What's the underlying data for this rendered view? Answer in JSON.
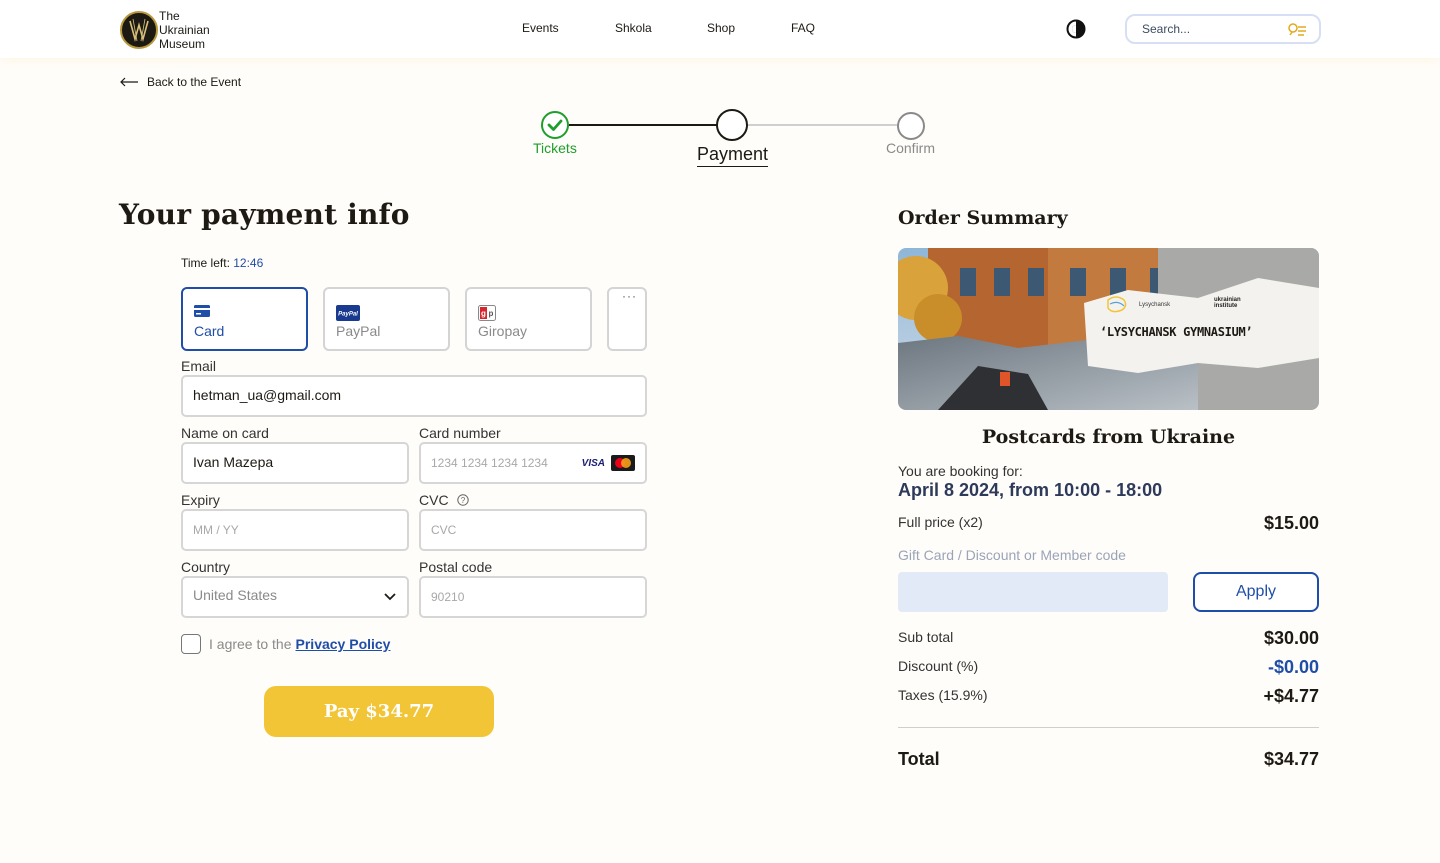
{
  "header": {
    "logo_lines": [
      "The",
      "Ukrainian",
      "Museum"
    ],
    "nav": [
      "Events",
      "Shkola",
      "Shop",
      "FAQ"
    ],
    "search_placeholder": "Search..."
  },
  "back_link": "Back to the Event",
  "stepper": {
    "steps": [
      {
        "label": "Tickets",
        "state": "done"
      },
      {
        "label": "Payment",
        "state": "current"
      },
      {
        "label": "Confirm",
        "state": "upcoming"
      }
    ]
  },
  "payment": {
    "title": "Your payment info",
    "time_left_label": "Time left:",
    "time_left_value": "12:46",
    "methods": [
      {
        "label": "Card",
        "icon": "card-icon",
        "active": true
      },
      {
        "label": "PayPal",
        "icon": "paypal-icon",
        "active": false
      },
      {
        "label": "Giropay",
        "icon": "giropay-icon",
        "active": false
      }
    ],
    "more_label": "···",
    "email": {
      "label": "Email",
      "value": "hetman_ua@gmail.com"
    },
    "name_on_card": {
      "label": "Name on card",
      "value": "Ivan Mazepa"
    },
    "card_number": {
      "label": "Card number",
      "placeholder": "1234 1234 1234 1234",
      "brands": [
        "VISA",
        "mastercard"
      ]
    },
    "expiry": {
      "label": "Expiry",
      "placeholder": "MM / YY"
    },
    "cvc": {
      "label": "CVC",
      "placeholder": "CVC"
    },
    "country": {
      "label": "Country",
      "value": "United States"
    },
    "postal_code": {
      "label": "Postal code",
      "placeholder": "90210"
    },
    "agree_text": "I agree to the",
    "privacy_link": "Privacy Policy",
    "pay_button": "Pay $34.77"
  },
  "summary": {
    "title": "Order Summary",
    "banner_text": "‘LYSYCHANSK GYMNASIUM’",
    "banner_org1": "Lysychansk",
    "banner_org2": "ukrainian institute",
    "event_name": "Postcards from Ukraine",
    "booking_for": "You are booking for:",
    "booking_date": "April 8 2024, from 10:00 - 18:00",
    "full_price_label": "Full price (x2)",
    "full_price_value": "$15.00",
    "discount_code_label": "Gift Card / Discount or Member code",
    "apply_button": "Apply",
    "subtotal_label": "Sub total",
    "subtotal_value": "$30.00",
    "discount_label": "Discount (%)",
    "discount_value": "-$0.00",
    "taxes_label": "Taxes (15.9%)",
    "taxes_value": "+$4.77",
    "total_label": "Total",
    "total_value": "$34.77"
  },
  "colors": {
    "accent_blue": "#1f4ea8",
    "success_green": "#1e9e2a",
    "pay_yellow": "#f2c537"
  }
}
